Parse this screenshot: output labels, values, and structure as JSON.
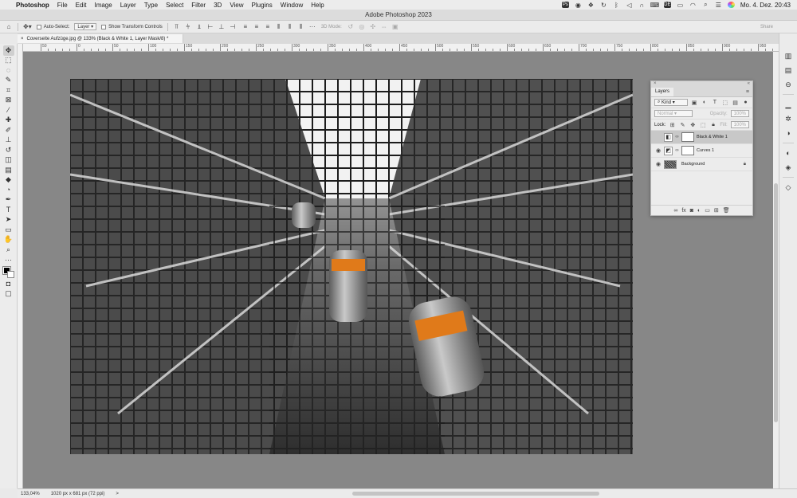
{
  "menubar": {
    "apple_icon": "apple-logo-icon",
    "app_name": "Photoshop",
    "items": [
      "File",
      "Edit",
      "Image",
      "Layer",
      "Type",
      "Select",
      "Filter",
      "3D",
      "View",
      "Plugins",
      "Window",
      "Help"
    ],
    "clock": "Mo. 4. Dez.  20:43",
    "status_icon_names": [
      "photoshop-icon",
      "record-icon",
      "dropbox-icon",
      "sync-icon",
      "bluetooth-icon",
      "volume-icon",
      "headphones-icon",
      "keyboard-icon",
      "input-de-icon",
      "battery-icon",
      "wifi-icon",
      "search-icon",
      "control-center-icon",
      "siri-icon"
    ]
  },
  "window": {
    "title": "Adobe Photoshop 2023"
  },
  "options_bar": {
    "auto_select_label": "Auto-Select:",
    "auto_select_value": "Layer",
    "show_transform_label": "Show Transform Controls",
    "mode_3d_label": "3D Mode:",
    "share_label": "Share"
  },
  "document": {
    "tab_title": "Coverseite Aufzüge.jpg @ 133% (Black & White 1, Layer Mask/8) *",
    "close_glyph": "×"
  },
  "ruler": {
    "labels": [
      "50",
      "0",
      "50",
      "100",
      "150",
      "200",
      "250",
      "300",
      "350",
      "400",
      "450",
      "500",
      "550",
      "600",
      "650",
      "700",
      "750",
      "800",
      "850",
      "900",
      "950",
      "1000",
      "1050"
    ]
  },
  "layers_panel": {
    "tab_label": "Layers",
    "close_glyph": "×",
    "collapse_glyph": "«",
    "filter_label": "Kind",
    "blend_mode": "Normal",
    "opacity_label": "Opacity:",
    "opacity_value": "100%",
    "lock_label": "Lock:",
    "fill_label": "Fill:",
    "fill_value": "100%",
    "layers": [
      {
        "name": "Black & White 1",
        "selected": true,
        "visible": false,
        "thumb_glyph": "◧"
      },
      {
        "name": "Curves 1",
        "selected": false,
        "visible": true,
        "thumb_glyph": "◩"
      },
      {
        "name": "Background",
        "selected": false,
        "visible": true,
        "locked": true
      }
    ]
  },
  "status_bar": {
    "zoom": "133,04%",
    "doc_info": "1020 px x 681 px (72 ppi)",
    "arrow": ">"
  },
  "colors": {
    "canvas_bg": "#878787",
    "ui_bg": "#ececec",
    "accent_orange": "#e07a1a",
    "selected_layer": "#c8c8c8"
  }
}
